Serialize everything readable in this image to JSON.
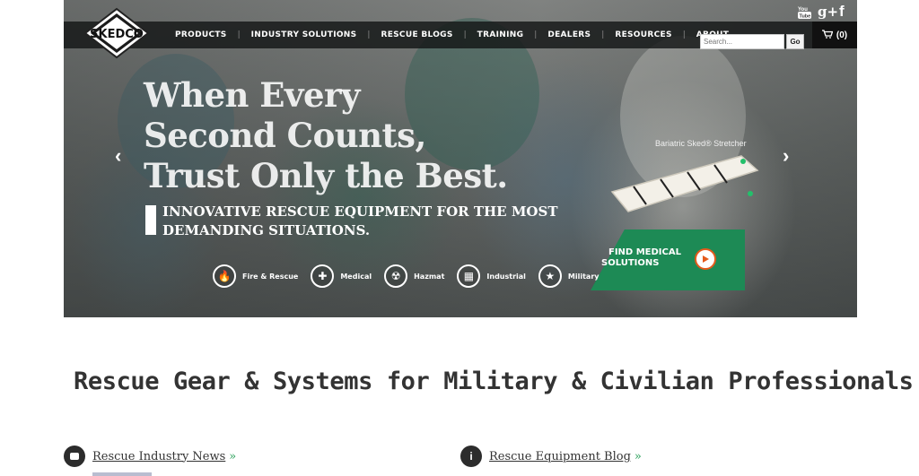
{
  "nav": {
    "items": [
      {
        "label": "PRODUCTS"
      },
      {
        "label": "INDUSTRY SOLUTIONS"
      },
      {
        "label": "RESCUE BLOGS"
      },
      {
        "label": "TRAINING"
      },
      {
        "label": "DEALERS"
      },
      {
        "label": "RESOURCES"
      },
      {
        "label": "ABOUT"
      }
    ],
    "separator": "|",
    "search_placeholder": "Search...",
    "go_label": "Go",
    "cart_label": "(0)"
  },
  "logo": {
    "text": "SKEDCO"
  },
  "social": {
    "youtube": "You Tube",
    "google": "g+",
    "facebook": "f"
  },
  "hero": {
    "headline": [
      "When Every",
      "Second Counts,",
      "Trust Only the Best."
    ],
    "tagline": [
      "INNOVATIVE RESCUE EQUIPMENT FOR THE MOST",
      "DEMANDING SITUATIONS."
    ],
    "product_label": "Bariatric Sked® Stretcher",
    "find_line1": "FIND MEDICAL",
    "find_line2": "SOLUTIONS",
    "categories": [
      {
        "label": "Fire & Rescue",
        "icon": "fire-icon"
      },
      {
        "label": "Medical",
        "icon": "medical-cross-icon"
      },
      {
        "label": "Hazmat",
        "icon": "radiation-icon"
      },
      {
        "label": "Industrial",
        "icon": "factory-icon"
      },
      {
        "label": "Military",
        "icon": "star-icon"
      }
    ],
    "prev": "‹",
    "next": "›"
  },
  "main": {
    "title": "Rescue Gear & Systems for Military & Civilian Professionals",
    "feeds": [
      {
        "label": "Rescue Industry News",
        "more": "»",
        "icon": "news-icon"
      },
      {
        "label": "Rescue Equipment Blog",
        "more": "»",
        "icon": "info-icon"
      }
    ]
  },
  "colors": {
    "accent_green": "#1d8a55",
    "nav_bg": "#141616",
    "play_orange": "#e55a1c"
  }
}
